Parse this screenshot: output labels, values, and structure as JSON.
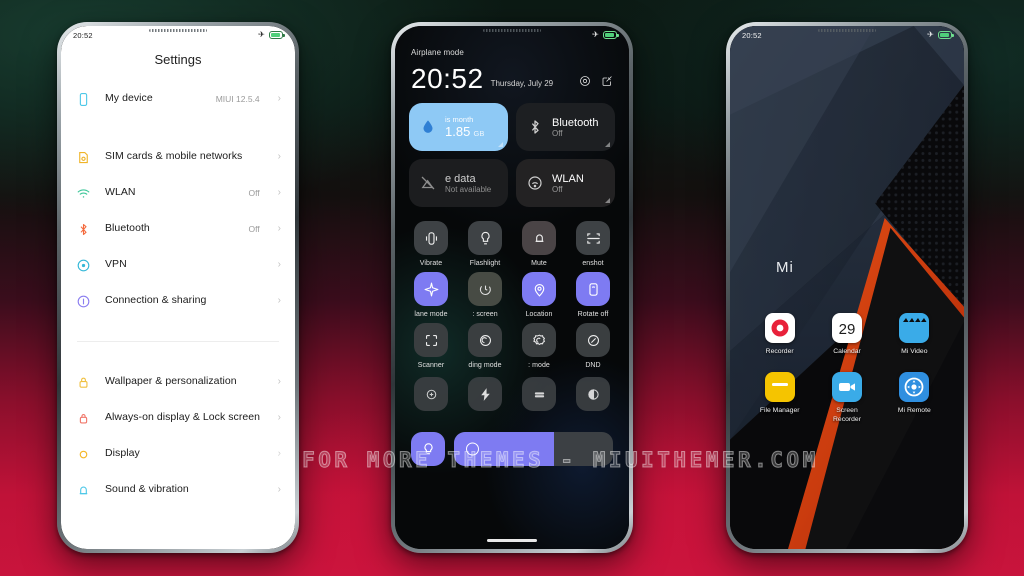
{
  "background": {
    "top_color": "#0c1a14",
    "mid_color": "#3a0d1c",
    "bottom_color": "#c8143c"
  },
  "watermark": {
    "text": "VISIT FOR MORE THEMES - MIUITHEMER.COM"
  },
  "phone1": {
    "statusbar": {
      "time": "20:52",
      "airplane_icon": "airplane-icon",
      "battery_icon": "battery-icon"
    },
    "title": "Settings",
    "items": [
      {
        "label": "My device",
        "value": "MIUI 12.5.4",
        "icon": "phone-icon",
        "color": "#4ec8e8"
      },
      {
        "label": "SIM cards & mobile networks",
        "value": "",
        "icon": "sim-card-icon",
        "color": "#f0b429"
      },
      {
        "label": "WLAN",
        "value": "Off",
        "icon": "wifi-icon",
        "color": "#3fc79a"
      },
      {
        "label": "Bluetooth",
        "value": "Off",
        "icon": "bluetooth-icon",
        "color": "#f4693c"
      },
      {
        "label": "VPN",
        "value": "",
        "icon": "vpn-icon",
        "color": "#35b8d8"
      },
      {
        "label": "Connection & sharing",
        "value": "",
        "icon": "connection-icon",
        "color": "#8b7ef0"
      }
    ],
    "items2": [
      {
        "label": "Wallpaper & personalization",
        "value": "",
        "icon": "wallpaper-lock-icon",
        "color": "#f0c040"
      },
      {
        "label": "Always-on display & Lock screen",
        "value": "",
        "icon": "lock-screen-icon",
        "color": "#f0776a"
      },
      {
        "label": "Display",
        "value": "",
        "icon": "brightness-icon",
        "color": "#f5b728"
      },
      {
        "label": "Sound & vibration",
        "value": "",
        "icon": "bell-icon",
        "color": "#4ec8e8"
      }
    ],
    "chevron": "›"
  },
  "phone2": {
    "statusbar": {
      "mode": "Airplane mode",
      "airplane_icon": "airplane-icon",
      "battery_icon": "battery-icon"
    },
    "clock": {
      "time": "20:52",
      "date": "Thursday, July 29"
    },
    "header_icons": [
      "settings-gear-icon",
      "edit-icon"
    ],
    "big_tiles": [
      {
        "title": "is month",
        "amount": "1.85",
        "unit": "GB",
        "state": "on",
        "icon": "data-usage-icon"
      },
      {
        "name": "Bluetooth",
        "sub": "Off",
        "state": "off",
        "icon": "bluetooth-icon"
      },
      {
        "name": "e data",
        "sub": "Not available",
        "state": "off",
        "icon": "mobile-data-off-icon"
      },
      {
        "name": "WLAN",
        "sub": "Off",
        "state": "off",
        "icon": "wlan-off-icon"
      }
    ],
    "toggles": [
      {
        "label": "Vibrate",
        "icon": "vibrate-icon",
        "state": "off"
      },
      {
        "label": "Flashlight",
        "icon": "flashlight-icon",
        "state": "off"
      },
      {
        "label": "Mute",
        "icon": "mute-bell-icon",
        "state": "off"
      },
      {
        "label": "enshot",
        "icon": "screenshot-icon",
        "state": "off"
      },
      {
        "label": "lane mode",
        "icon": "airplane-icon",
        "state": "on"
      },
      {
        "label": ": screen",
        "icon": "aod-clock-icon",
        "state": "off"
      },
      {
        "label": "Location",
        "icon": "location-pin-icon",
        "state": "on"
      },
      {
        "label": "Rotate off",
        "icon": "rotate-lock-icon",
        "state": "on"
      },
      {
        "label": "Scanner",
        "icon": "scanner-icon",
        "state": "off"
      },
      {
        "label": "ding mode",
        "icon": "reading-mode-icon",
        "state": "off"
      },
      {
        "label": ": mode",
        "icon": "dark-mode-icon",
        "state": "off"
      },
      {
        "label": "DND",
        "icon": "dnd-icon",
        "state": "off"
      }
    ],
    "toggles_row4": [
      {
        "label": "",
        "icon": "cast-icon",
        "state": "off"
      },
      {
        "label": "",
        "icon": "power-saver-icon",
        "state": "off"
      },
      {
        "label": "",
        "icon": "sync-icon",
        "state": "off"
      },
      {
        "label": "",
        "icon": "contrast-icon",
        "state": "off"
      }
    ],
    "brightness": {
      "icon": "brightness-bulb-icon",
      "percent": 63,
      "accent": "#7e7bf2"
    }
  },
  "phone3": {
    "statusbar": {
      "time": "20:52",
      "airplane_icon": "airplane-icon",
      "battery_icon": "battery-icon"
    },
    "widget": {
      "text": "Mi"
    },
    "apps_row1": [
      {
        "label": "Recorder",
        "icon": "recorder-icon",
        "bg": "#ffffff",
        "fg": "#e8213a"
      },
      {
        "label": "Calendar",
        "icon": "calendar-icon",
        "bg": "#ffffff",
        "fg": "#1c1c1c",
        "text": "29"
      },
      {
        "label": "Mi Video",
        "icon": "mi-video-icon",
        "bg": "#3aabe8",
        "fg": "#ffffff"
      }
    ],
    "apps_row2": [
      {
        "label": "File Manager",
        "icon": "file-manager-icon",
        "bg": "#f5c400",
        "fg": "#ffffff"
      },
      {
        "label": "Screen Recorder",
        "icon": "screen-recorder-icon",
        "bg": "#3aabe8",
        "fg": "#ffffff"
      },
      {
        "label": "Mi Remote",
        "icon": "mi-remote-icon",
        "bg": "#2f8fe0",
        "fg": "#ffffff"
      }
    ]
  }
}
